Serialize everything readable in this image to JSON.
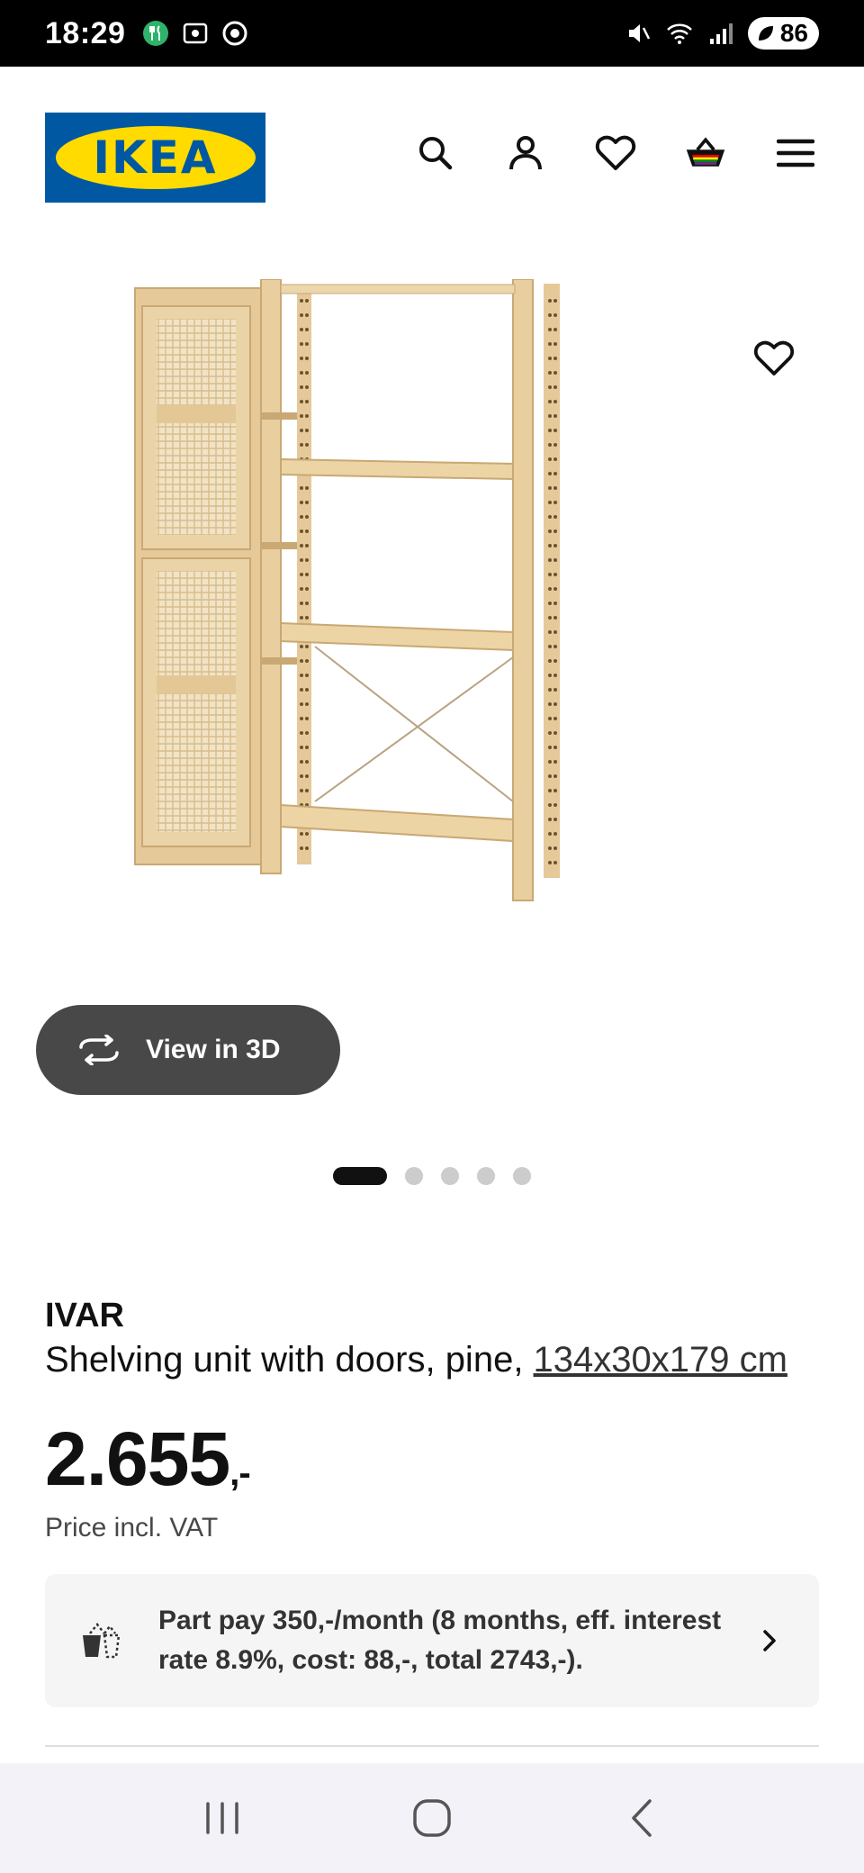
{
  "status": {
    "time": "18:29",
    "battery": "86"
  },
  "header": {
    "logo_text": "IKEA",
    "icons": [
      "search-icon",
      "account-icon",
      "heart-icon",
      "basket-icon",
      "menu-icon"
    ]
  },
  "gallery": {
    "view3d_label": "View in 3D",
    "dot_count": 5,
    "active_dot": 0
  },
  "product": {
    "name": "IVAR",
    "description": "Shelving unit with doors, pine, ",
    "measurements": "134x30x179 cm",
    "price": "2.655",
    "price_suffix": ",-",
    "price_note": "Price incl. VAT",
    "partpay_text": "Part pay 350,-/month (8 months, eff. interest rate 8.9%, cost: 88,-, total 2743,-)."
  },
  "colors": {
    "ikea_blue": "#0058a3",
    "ikea_yellow": "#ffdb00",
    "pine": "#e9cf9f"
  }
}
